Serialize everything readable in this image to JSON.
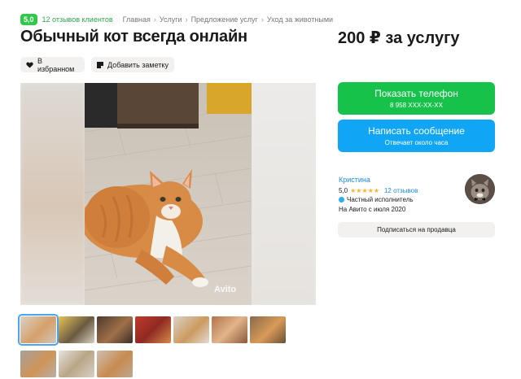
{
  "header": {
    "rating": "5,0",
    "reviews_link": "12 отзывов клиентов",
    "breadcrumbs": [
      "Главная",
      "Услуги",
      "Предложение услуг",
      "Уход за животными"
    ],
    "separator": "›"
  },
  "listing": {
    "title": "Обычный кот всегда онлайн",
    "price": "200 ₽ за услугу"
  },
  "actions": {
    "favorite": "В избранном",
    "note": "Добавить заметку"
  },
  "gallery": {
    "watermark": "Avito",
    "thumbnail_count": 11,
    "active_thumbnail": 1
  },
  "contact": {
    "phone_label": "Показать телефон",
    "phone_number": "8 958 XXX-XX-XX",
    "message_label": "Написать сообщение",
    "message_sub": "Отвечает около часа"
  },
  "seller": {
    "name": "Кристина",
    "rating": "5,0",
    "stars": "★★★★★",
    "reviews": "12 отзывов",
    "type": "Частный исполнитель",
    "since": "На Авито с июля 2020",
    "subscribe": "Подписаться на продавца"
  },
  "colors": {
    "green_button": "#17c24b",
    "blue_button": "#10a5f5",
    "rating_badge": "#2fc848",
    "link_blue": "#1b8be0",
    "star": "#ffb21e"
  },
  "icons": {
    "favorite": "heart-icon",
    "note": "note-icon",
    "verified": "check-badge-icon"
  }
}
